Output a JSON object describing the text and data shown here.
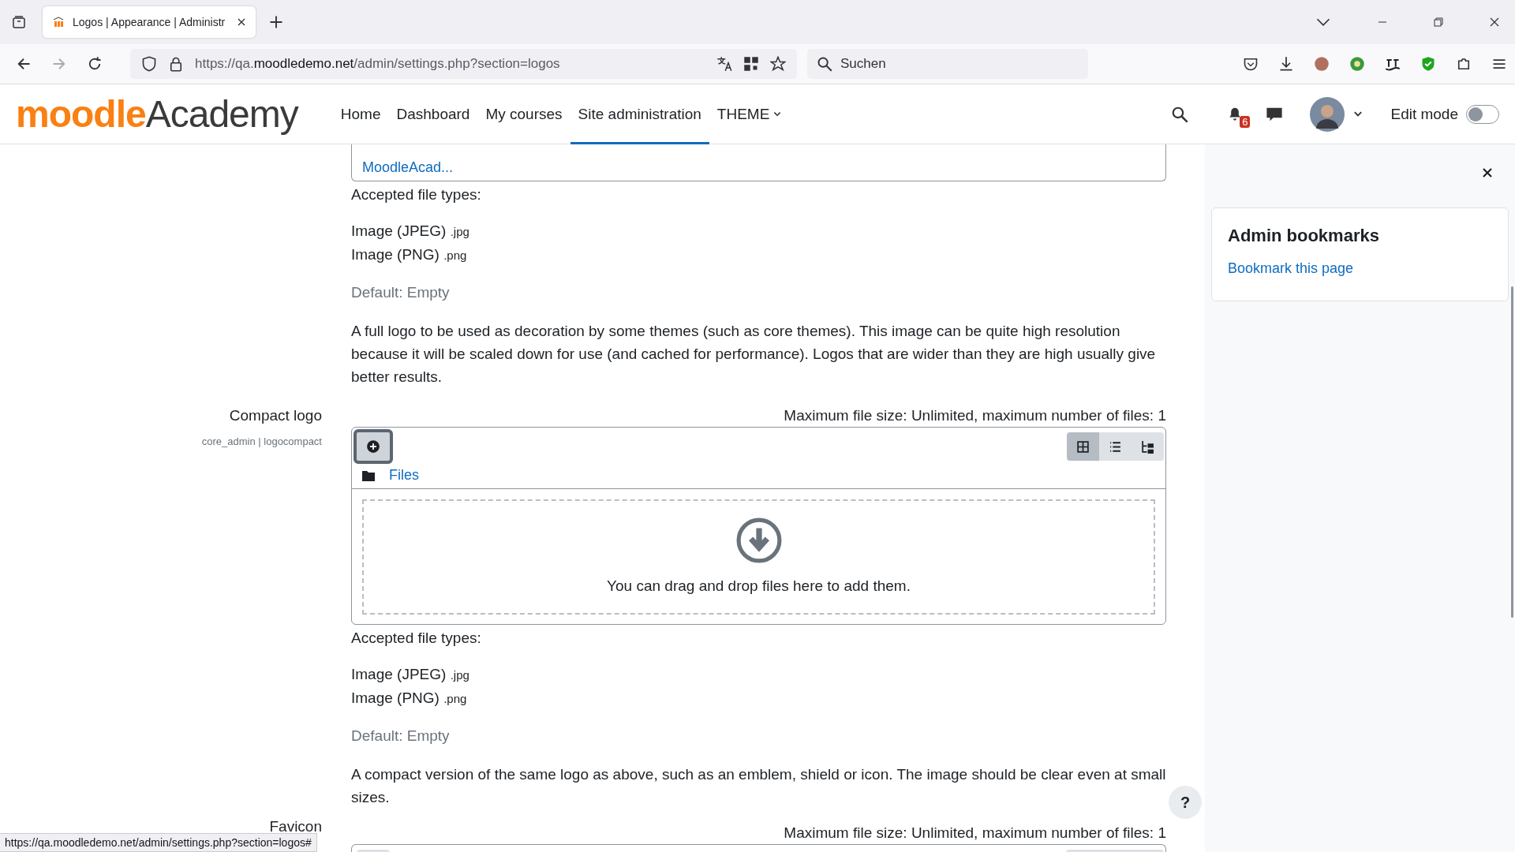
{
  "browser": {
    "tab_title": "Logos | Appearance | Administr",
    "url_scheme": "https://qa.",
    "url_host": "moodledemo.net",
    "url_path": "/admin/settings.php?section=logos",
    "search_placeholder": "Suchen"
  },
  "navbar": {
    "logo": {
      "part_1": "moodle",
      "part_2": "Academy"
    },
    "items": [
      {
        "label": "Home",
        "selected": false
      },
      {
        "label": "Dashboard",
        "selected": false
      },
      {
        "label": "My courses",
        "selected": false
      },
      {
        "label": "Site administration",
        "selected": true
      },
      {
        "label": "THEME",
        "selected": false,
        "kind": "dropdown"
      }
    ],
    "notification_count": "6",
    "edit_mode": {
      "label": "Edit mode",
      "on": false
    }
  },
  "settings": [
    {
      "kind": "partial",
      "file_link": "MoodleAcad...",
      "accepted_label": "Accepted file types:",
      "types": [
        {
          "name": "Image (JPEG)",
          "ext": ".jpg"
        },
        {
          "name": "Image (PNG)",
          "ext": ".png"
        }
      ],
      "default": "Default: Empty",
      "description": "A full logo to be used as decoration by some themes (such as core themes). This image can be quite high resolution because it will be scaled down for use (and cached for performance). Logos that are wider than they are high usually give better results."
    },
    {
      "kind": "full",
      "label": "Compact logo",
      "code": "core_admin | logocompact",
      "max": "Maximum file size: Unlimited, maximum number of files: 1",
      "files_link": "Files",
      "views": [
        {
          "kind": "grid",
          "selected": true
        },
        {
          "kind": "list",
          "selected": false
        },
        {
          "kind": "tree",
          "selected": false
        }
      ],
      "drop_text": "You can drag and drop files here to add them.",
      "accepted_label": "Accepted file types:",
      "types": [
        {
          "name": "Image (JPEG)",
          "ext": ".jpg"
        },
        {
          "name": "Image (PNG)",
          "ext": ".png"
        }
      ],
      "default": "Default: Empty",
      "description": "A compact version of the same logo as above, such as an emblem, shield or icon. The image should be clear even at small sizes."
    },
    {
      "kind": "cut",
      "label": "Favicon",
      "max": "Maximum file size: Unlimited, maximum number of files: 1"
    }
  ],
  "drawer": {
    "title": "Admin bookmarks",
    "link": "Bookmark this page"
  },
  "help": "?",
  "status_url": "https://qa.moodledemo.net/admin/settings.php?section=logos#"
}
